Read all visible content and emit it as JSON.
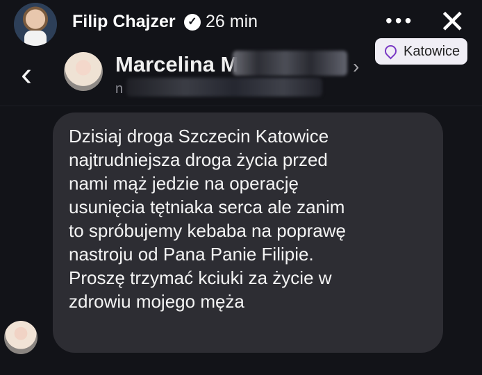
{
  "header": {
    "poster_name": "Filip Chajzer",
    "time": "26 min",
    "more_label": "•••",
    "close_label": "✕",
    "location_label": "Katowice"
  },
  "conversation": {
    "back_label": "‹",
    "recipient_name": "Marcelina M",
    "recipient_chevron": "›",
    "username_initial": "n"
  },
  "message": {
    "lines": [
      "Dzisiaj droga  Szczecin Katowice",
      "najtrudniejsza droga życia przed",
      "nami mąż jedzie na operację",
      "usunięcia tętniaka serca ale zanim",
      "to spróbujemy kebaba na poprawę",
      "nastroju od Pana Panie Filipie.",
      "Proszę trzymać kciuki za życie w",
      "zdrowiu mojego męża"
    ]
  },
  "icons": {
    "verified": "check-badge-icon",
    "location": "location-pin-icon",
    "more": "more-icon",
    "close": "close-icon",
    "back": "chevron-left-icon"
  }
}
